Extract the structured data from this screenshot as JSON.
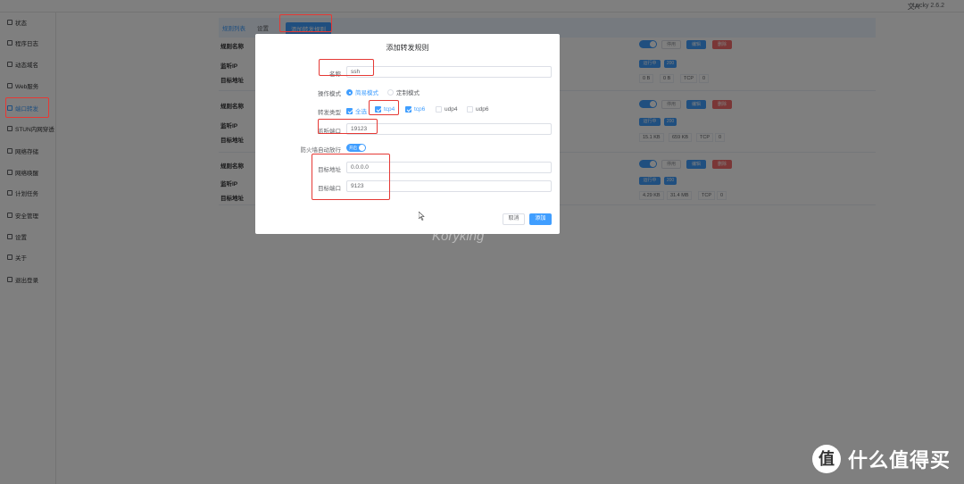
{
  "app": {
    "version": "Lucky 2.6.2",
    "lang_icon": "translate-icon"
  },
  "sidebar": {
    "items": [
      {
        "label": "状态",
        "icon": "home-icon"
      },
      {
        "label": "程序日志",
        "icon": "log-icon"
      },
      {
        "label": "动态域名",
        "icon": "ddns-icon"
      },
      {
        "label": "Web服务",
        "icon": "web-icon"
      },
      {
        "label": "端口转发",
        "icon": "port-forward-icon"
      },
      {
        "label": "STUN内网穿透",
        "icon": "stun-icon"
      },
      {
        "label": "网络存储",
        "icon": "storage-icon"
      },
      {
        "label": "网络唤醒",
        "icon": "wake-icon"
      },
      {
        "label": "计划任务",
        "icon": "schedule-icon"
      },
      {
        "label": "安全管理",
        "icon": "security-icon"
      },
      {
        "label": "设置",
        "icon": "settings-icon"
      },
      {
        "label": "关于",
        "icon": "about-icon"
      },
      {
        "label": "退出登录",
        "icon": "logout-icon"
      }
    ]
  },
  "tabs": {
    "list": "规则列表",
    "settings": "设置",
    "add": "添加转发规则"
  },
  "rules": [
    {
      "name_label": "规则名称",
      "ip_label": "监听IP",
      "target_label": "目标地址",
      "sw_label": "开",
      "stop_label": "停用",
      "edit": "编辑",
      "delete": "删除",
      "pill1": "运行中",
      "pill2": "200",
      "stat1": "0 B",
      "stat2": "0 B",
      "proto": "TCP",
      "conn": "0"
    },
    {
      "name_label": "规则名称",
      "ip_label": "监听IP",
      "target_label": "目标地址",
      "sw_label": "开",
      "stop_label": "停用",
      "edit": "编辑",
      "delete": "删除",
      "pill1": "运行中",
      "pill2": "200",
      "stat1": "15.1 KB",
      "stat2": "659 KB",
      "proto": "TCP",
      "conn": "0"
    },
    {
      "name_label": "规则名称",
      "ip_label": "监听IP",
      "target_label": "目标地址",
      "sw_label": "开",
      "stop_label": "停用",
      "edit": "编辑",
      "delete": "删除",
      "pill1": "运行中",
      "pill2": "200",
      "stat1": "4.29 KB",
      "stat2": "31.4 MB",
      "proto": "TCP",
      "conn": "0"
    }
  ],
  "dialog": {
    "title": "添加转发规则",
    "name_label": "名称",
    "name_value": "ssh",
    "mode_label": "操作模式",
    "mode_simple": "简易模式",
    "mode_custom": "定制模式",
    "type_label": "转发类型",
    "type_all": "全选",
    "type_tcp4": "tcp4",
    "type_tcp6": "tcp6",
    "type_udp4": "udp4",
    "type_udp6": "udp6",
    "port_label": "监听端口",
    "port_value": "19123",
    "firewall_label": "防火墙自动放行",
    "firewall_toggle": "开启",
    "target_addr_label": "目标地址",
    "target_addr_value": "0.0.0.0",
    "target_port_label": "目标端口",
    "target_port_value": "9123",
    "cancel": "取消",
    "add": "添加"
  },
  "watermark": "Koryking",
  "brand": {
    "logo": "值",
    "text": "什么值得买"
  }
}
